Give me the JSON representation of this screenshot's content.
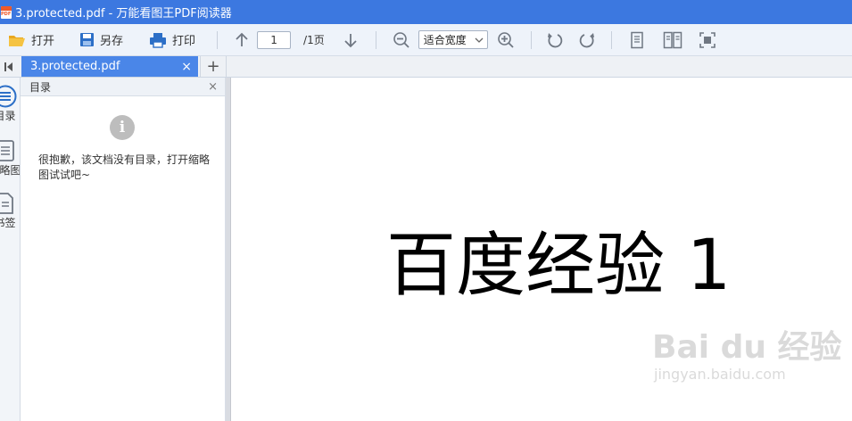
{
  "window": {
    "title": "3.protected.pdf - 万能看图王PDF阅读器"
  },
  "toolbar": {
    "open_label": "打开",
    "save_as_label": "另存",
    "print_label": "打印",
    "page_current": "1",
    "page_total": "/1页",
    "zoom_mode": "适合宽度"
  },
  "tabs": [
    {
      "title": "3.protected.pdf",
      "close": "×"
    }
  ],
  "tab_add": "+",
  "rail": {
    "items": [
      {
        "label": "目录",
        "icon": "list-icon"
      },
      {
        "label": "缩略图",
        "icon": "thumbnail-icon"
      },
      {
        "label": "书签",
        "icon": "bookmark-icon"
      }
    ]
  },
  "sidebar": {
    "title": "目录",
    "close": "×",
    "info_glyph": "i",
    "message": "很抱歉，该文档没有目录，打开缩略图试试吧~"
  },
  "document": {
    "text": "百度经验 1",
    "watermark_brand": "Bai du 经验",
    "watermark_url": "jingyan.baidu.com"
  },
  "colors": {
    "titlebar": "#3c78e0",
    "active_tab": "#4a86e8",
    "icon_blue": "#2c6fc7",
    "icon_gray": "#6f7782"
  }
}
